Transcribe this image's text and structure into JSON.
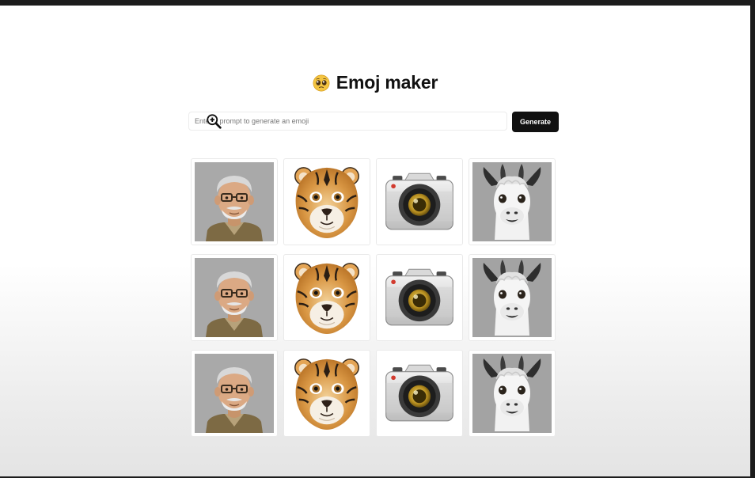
{
  "app": {
    "title": "Emoj maker",
    "title_emoji": "pleading-face-emoji"
  },
  "prompt": {
    "placeholder": "Enter a prompt to generate an emoji",
    "value": ""
  },
  "actions": {
    "generate_label": "Generate"
  },
  "gallery": {
    "columns": 4,
    "rows": [
      [
        "man-with-glasses-emoji",
        "tiger-face-emoji",
        "camera-emoji",
        "llama-face-emoji"
      ],
      [
        "man-with-glasses-emoji",
        "tiger-face-emoji",
        "camera-emoji",
        "llama-face-emoji"
      ],
      [
        "man-with-glasses-emoji",
        "tiger-face-emoji",
        "camera-emoji",
        "llama-face-emoji"
      ]
    ]
  },
  "cursor": {
    "icon": "zoom-in-cursor-icon"
  },
  "colors": {
    "button_bg": "#111111",
    "button_text": "#ffffff",
    "card_border": "#e9e9e9"
  }
}
